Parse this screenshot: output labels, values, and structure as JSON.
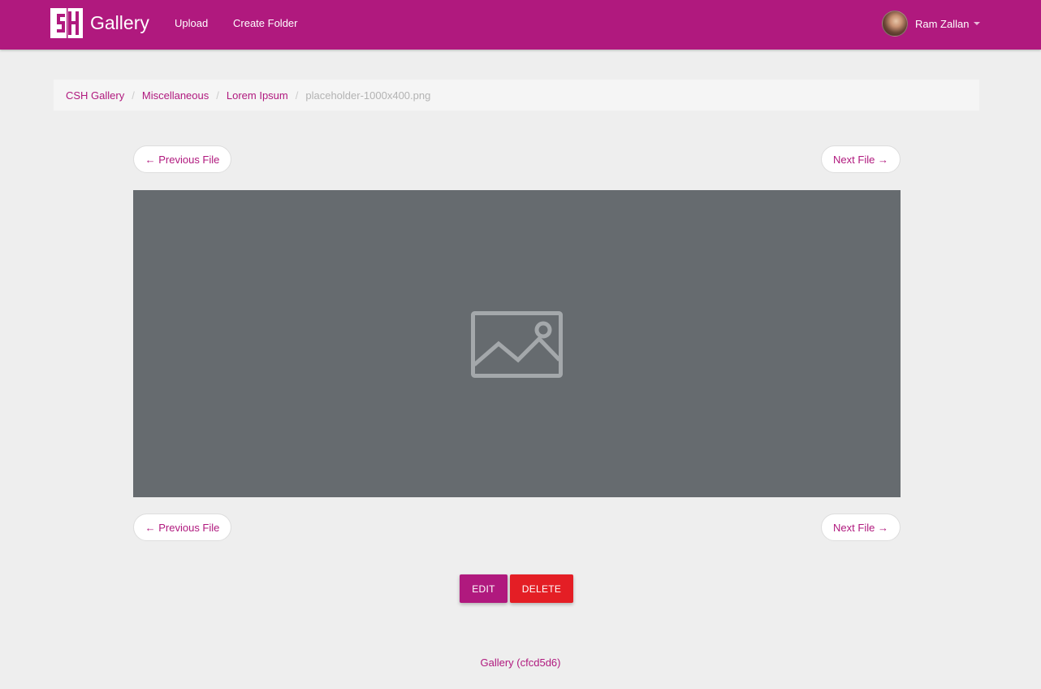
{
  "navbar": {
    "brand": "Gallery",
    "links": [
      "Upload",
      "Create Folder"
    ],
    "user_name": "Ram Zallan"
  },
  "breadcrumb": {
    "items": [
      "CSH Gallery",
      "Miscellaneous",
      "Lorem Ipsum"
    ],
    "current": "placeholder-1000x400.png"
  },
  "navigation": {
    "previous_label": "← Previous File",
    "next_label": "Next File →"
  },
  "actions": {
    "edit_label": "EDIT",
    "delete_label": "DELETE"
  },
  "footer": {
    "text": "Gallery (cfcd5d6)"
  },
  "colors": {
    "primary": "#b0197e",
    "danger": "#e41e25",
    "placeholder_bg": "#666b6f"
  },
  "icons": {
    "logo": "csh-logo-icon",
    "image": "image-placeholder-icon",
    "caret": "caret-down-icon"
  }
}
